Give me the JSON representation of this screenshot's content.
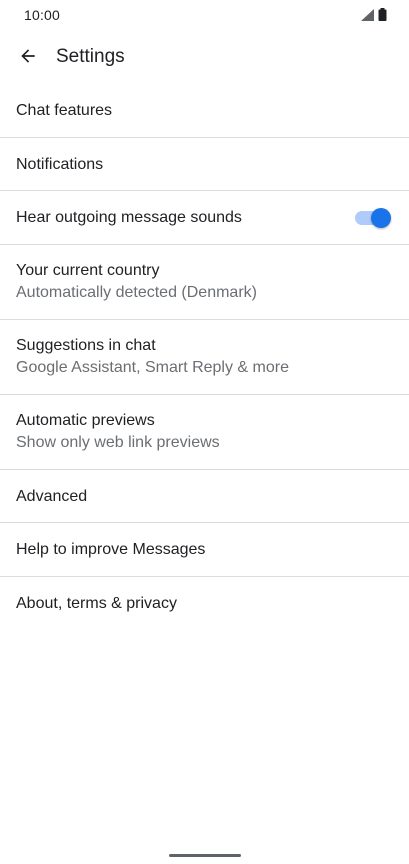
{
  "status_bar": {
    "time": "10:00",
    "icons": [
      "signal-icon",
      "battery-icon"
    ]
  },
  "app_bar": {
    "back_icon": "arrow-back-icon",
    "title": "Settings"
  },
  "settings": {
    "chat_features": {
      "label": "Chat features"
    },
    "notifications": {
      "label": "Notifications"
    },
    "outgoing_sounds": {
      "label": "Hear outgoing message sounds",
      "toggle_on": true
    },
    "current_country": {
      "label": "Your current country",
      "sublabel": "Automatically detected (Denmark)"
    },
    "suggestions": {
      "label": "Suggestions in chat",
      "sublabel": "Google Assistant, Smart Reply & more"
    },
    "previews": {
      "label": "Automatic previews",
      "sublabel": "Show only web link previews"
    },
    "advanced": {
      "label": "Advanced"
    },
    "help_improve": {
      "label": "Help to improve Messages"
    },
    "about": {
      "label": "About, terms & privacy"
    }
  },
  "colors": {
    "accent": "#1a73e8",
    "toggle_track": "#aecbfa",
    "divider": "#dadce0",
    "secondary_text": "#6b6e72"
  }
}
